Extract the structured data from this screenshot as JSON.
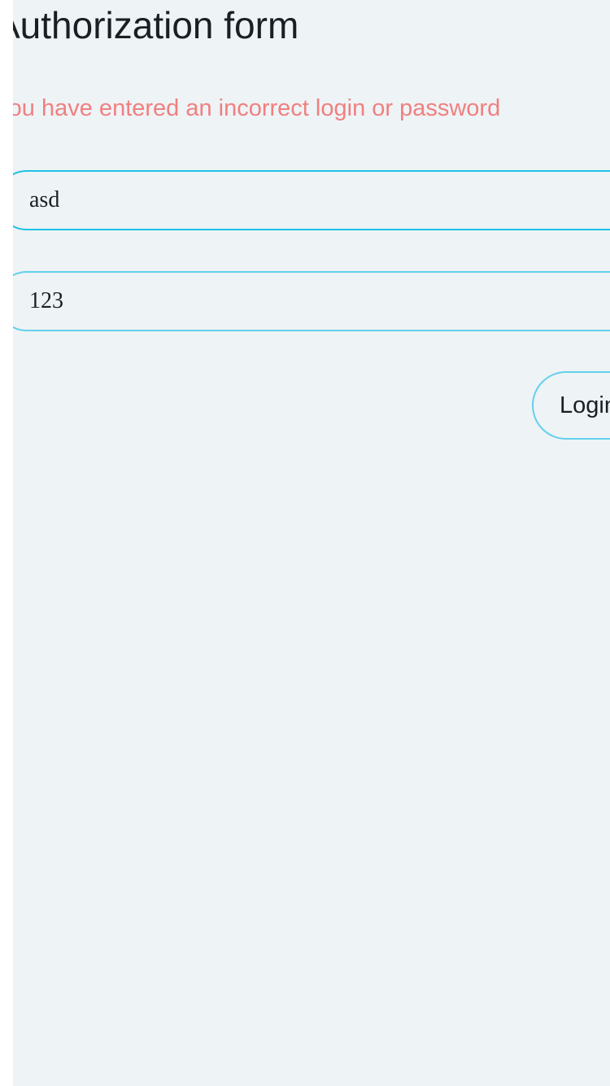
{
  "form": {
    "title": "Authorization form",
    "error_message": "You have entered an incorrect login or password",
    "login_field": {
      "value": "asd"
    },
    "password_field": {
      "value": "123"
    },
    "submit_label": "Login"
  },
  "colors": {
    "background": "#eef3f6",
    "error_text": "#f08080",
    "field_border_focused": "#1cc3e6",
    "field_border": "#63d0ec",
    "text": "#1b1f24"
  }
}
